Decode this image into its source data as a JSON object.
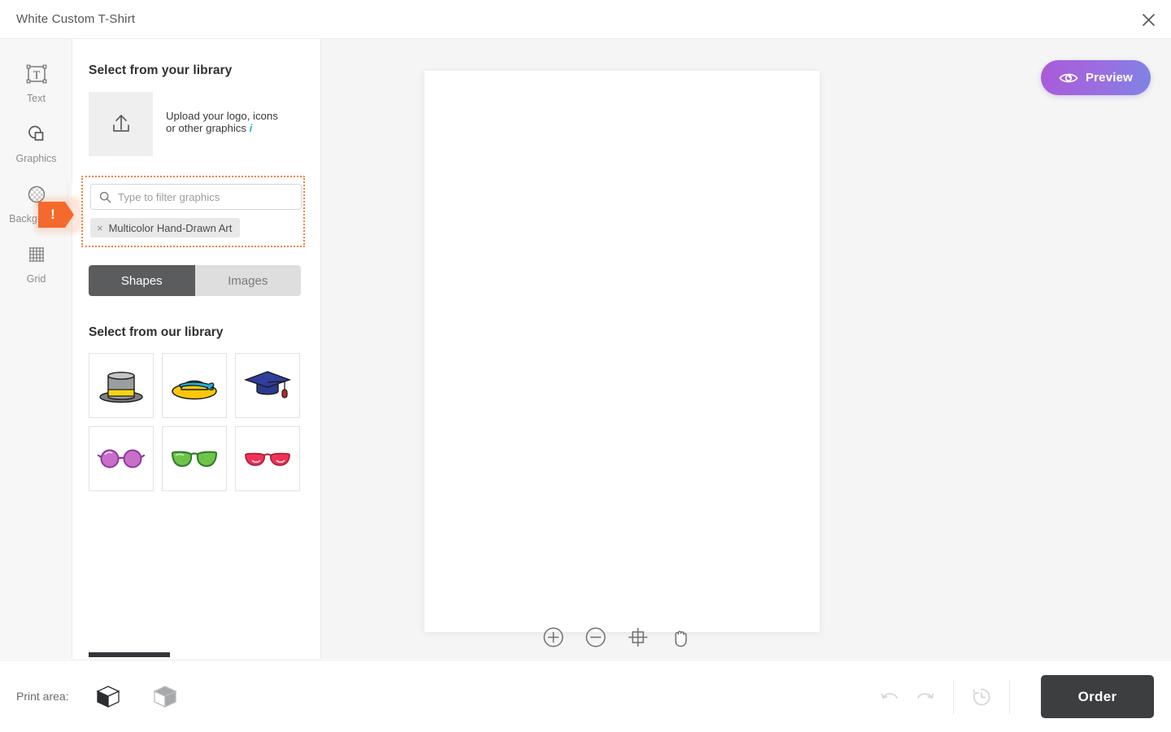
{
  "titlebar": {
    "title": "White Custom T-Shirt",
    "close_icon": "close-icon"
  },
  "rail": {
    "items": [
      {
        "label": "Text",
        "icon": "text-box-icon"
      },
      {
        "label": "Graphics",
        "icon": "shapes-icon"
      },
      {
        "label": "Background",
        "icon": "transparency-circle-icon"
      },
      {
        "label": "Grid",
        "icon": "grid-icon"
      }
    ],
    "badge": {
      "symbol": "!",
      "color": "#f4692c",
      "name": "warning-badge"
    }
  },
  "panel": {
    "your_library_title": "Select from your library",
    "upload": {
      "icon": "upload-icon",
      "text_line1": "Upload your logo, icons",
      "text_line2": "or other graphics",
      "info_icon": "info-icon",
      "info_glyph": "i"
    },
    "search": {
      "placeholder": "Type to filter graphics",
      "value": "",
      "icon": "search-icon"
    },
    "filter_tag": {
      "label": "Multicolor Hand-Drawn Art",
      "remove_glyph": "×"
    },
    "highlight_color": "#f2813f",
    "segments": [
      {
        "label": "Shapes",
        "active": true
      },
      {
        "label": "Images",
        "active": false
      }
    ],
    "our_library_title": "Select from our library",
    "graphics": [
      {
        "name": "top-hat-graphic"
      },
      {
        "name": "sun-hat-graphic"
      },
      {
        "name": "graduation-cap-graphic"
      },
      {
        "name": "round-glasses-graphic"
      },
      {
        "name": "green-sunglasses-graphic"
      },
      {
        "name": "red-aviator-glasses-graphic"
      }
    ]
  },
  "stage": {
    "preview_button": {
      "label": "Preview",
      "icon": "eye-icon"
    },
    "zoom_tools": [
      {
        "name": "zoom-in-icon"
      },
      {
        "name": "zoom-out-icon"
      },
      {
        "name": "fit-to-screen-icon"
      },
      {
        "name": "pan-hand-icon"
      }
    ]
  },
  "bottombar": {
    "print_area_label": "Print area:",
    "print_areas": [
      {
        "name": "print-area-front",
        "selected": true
      },
      {
        "name": "print-area-back",
        "selected": false
      }
    ],
    "undo_icon": "undo-icon",
    "redo_icon": "redo-icon",
    "history_icon": "history-icon",
    "order_label": "Order"
  }
}
